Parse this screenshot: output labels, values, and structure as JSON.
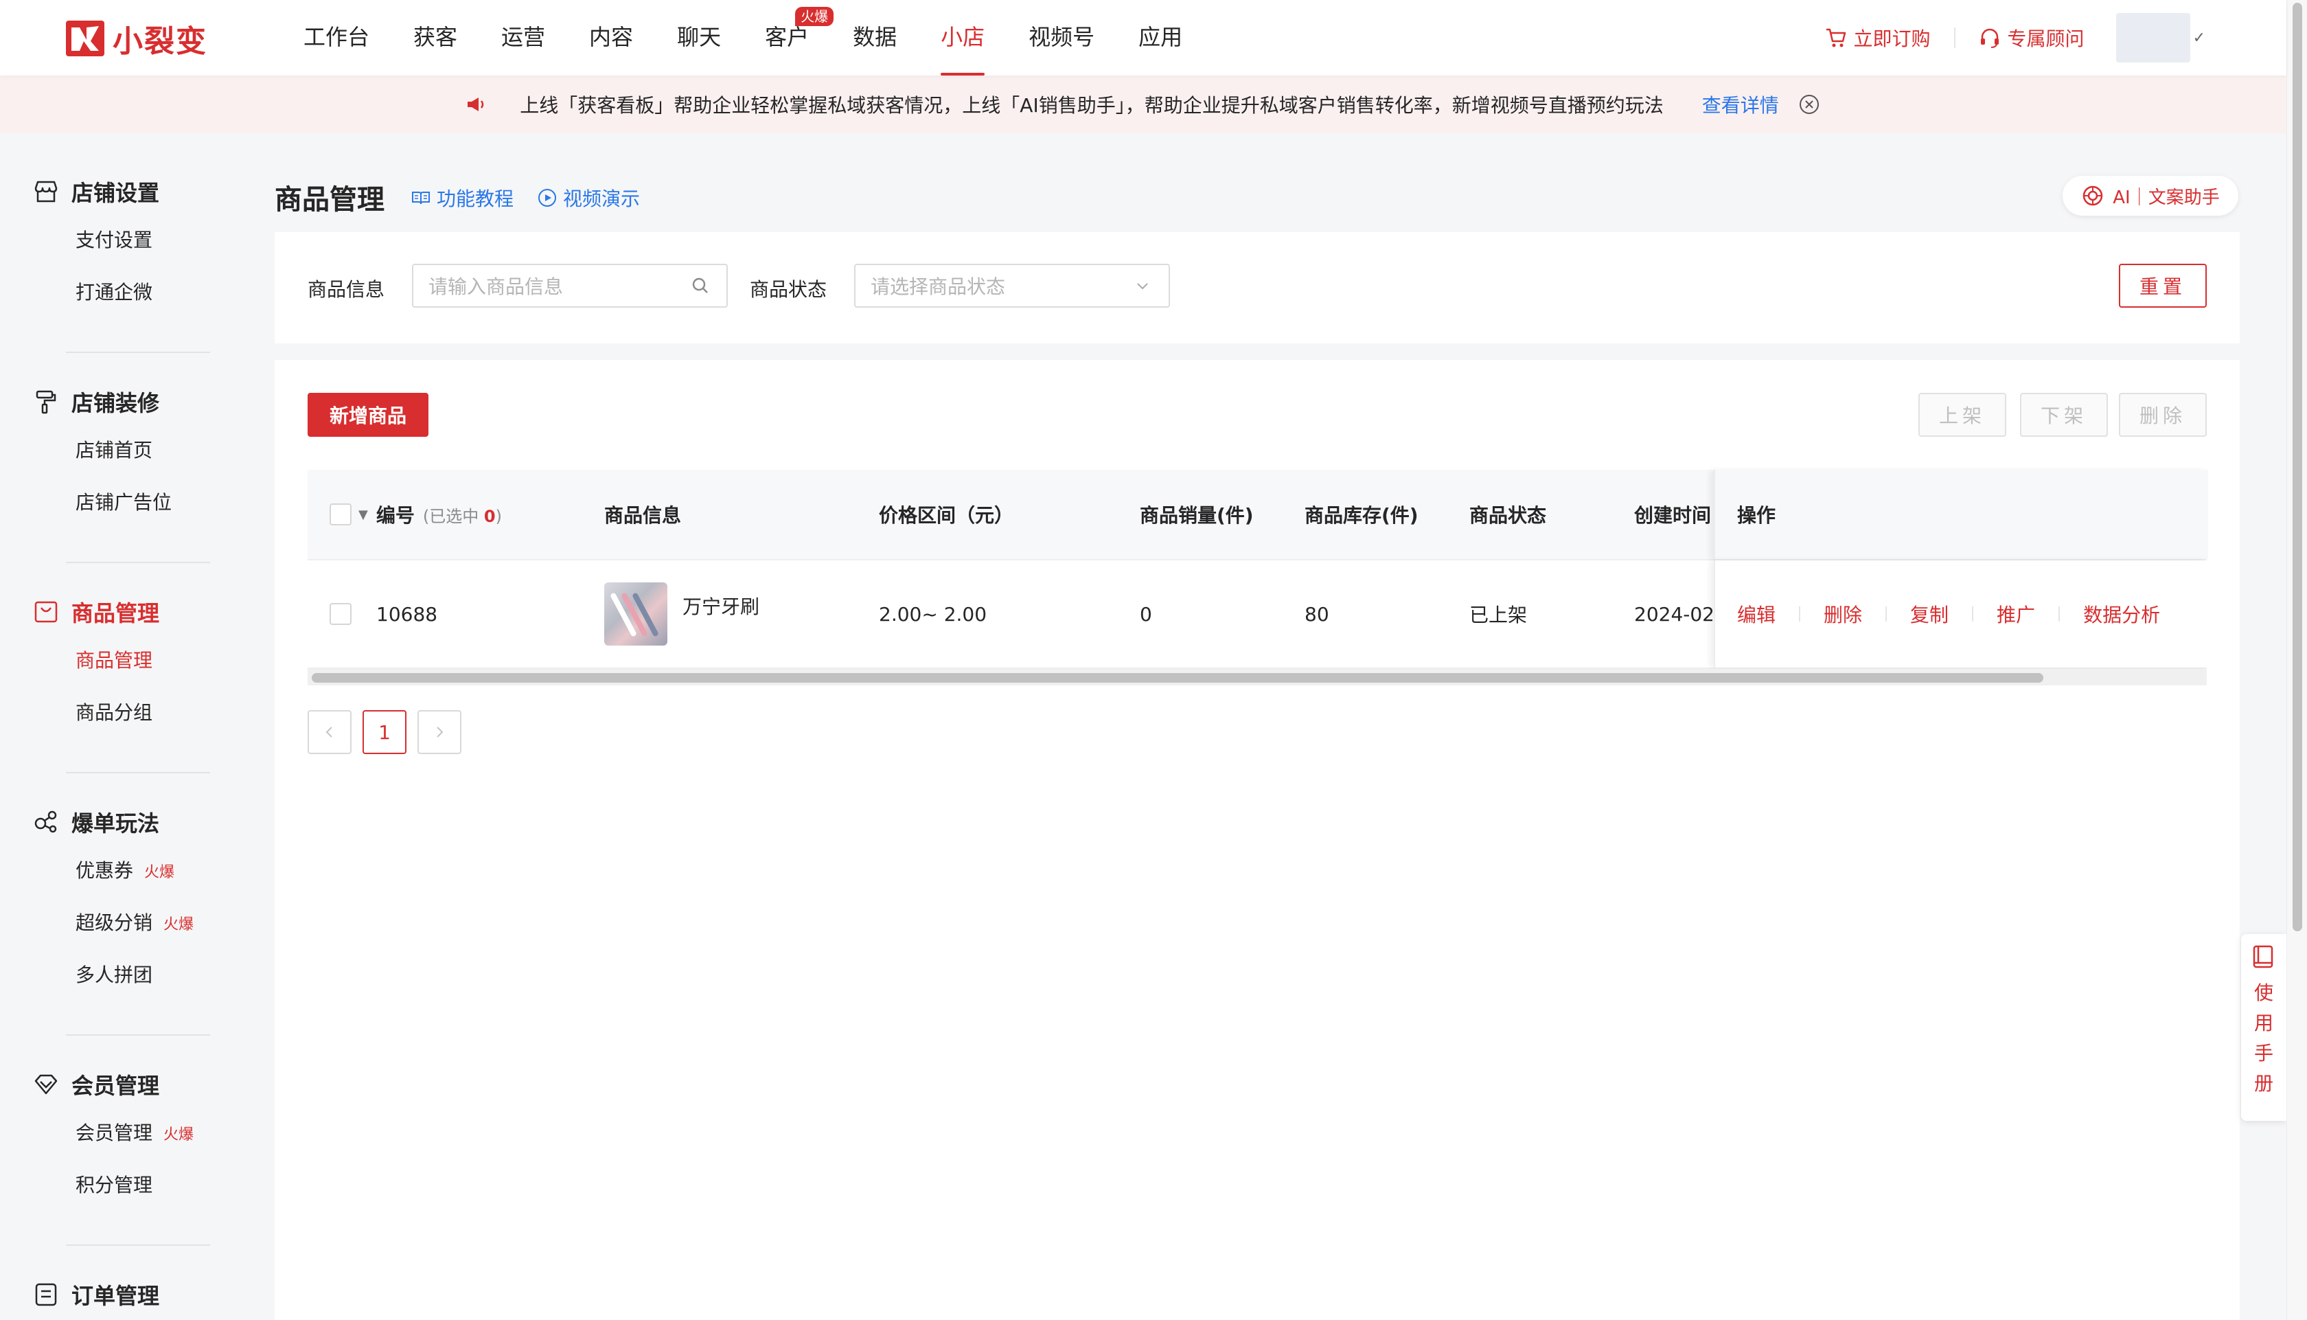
{
  "brand": {
    "name": "小裂变"
  },
  "nav": {
    "items": [
      {
        "label": "工作台"
      },
      {
        "label": "获客"
      },
      {
        "label": "运营"
      },
      {
        "label": "内容"
      },
      {
        "label": "聊天"
      },
      {
        "label": "客户",
        "badge": "火爆"
      },
      {
        "label": "数据"
      },
      {
        "label": "小店",
        "active": true
      },
      {
        "label": "视频号"
      },
      {
        "label": "应用"
      }
    ],
    "order_now": "立即订购",
    "advisor": "专属顾问"
  },
  "notice": {
    "text": "上线「获客看板」帮助企业轻松掌握私域获客情况，上线「AI销售助手」，帮助企业提升私域客户销售转化率，新增视频号直播预约玩法",
    "link": "查看详情"
  },
  "sidebar": {
    "groups": [
      {
        "title": "店铺设置",
        "icon": "store-icon",
        "items": [
          {
            "label": "支付设置"
          },
          {
            "label": "打通企微"
          }
        ]
      },
      {
        "title": "店铺装修",
        "icon": "paint-roller-icon",
        "items": [
          {
            "label": "店铺首页"
          },
          {
            "label": "店铺广告位"
          }
        ]
      },
      {
        "title": "商品管理",
        "icon": "shopping-bag-icon",
        "active": true,
        "items": [
          {
            "label": "商品管理",
            "active": true
          },
          {
            "label": "商品分组"
          }
        ]
      },
      {
        "title": "爆单玩法",
        "icon": "share-nodes-icon",
        "items": [
          {
            "label": "优惠券",
            "hot": "火爆"
          },
          {
            "label": "超级分销",
            "hot": "火爆"
          },
          {
            "label": "多人拼团"
          }
        ]
      },
      {
        "title": "会员管理",
        "icon": "diamond-icon",
        "items": [
          {
            "label": "会员管理",
            "hot": "火爆"
          },
          {
            "label": "积分管理"
          }
        ]
      },
      {
        "title": "订单管理",
        "icon": "order-list-icon",
        "items": []
      }
    ]
  },
  "page": {
    "title": "商品管理",
    "tutorial": "功能教程",
    "video_demo": "视频演示",
    "ai_assistant": "AI｜文案助手"
  },
  "filters": {
    "product_info_label": "商品信息",
    "product_info_placeholder": "请输入商品信息",
    "product_status_label": "商品状态",
    "product_status_placeholder": "请选择商品状态",
    "reset": "重置"
  },
  "actions": {
    "add_product": "新增商品",
    "list_on": "上架",
    "list_off": "下架",
    "delete": "删除"
  },
  "table": {
    "columns": {
      "id": "编号",
      "selected_prefix": "(已选中",
      "selected_count": "0",
      "selected_suffix": ")",
      "product_info": "商品信息",
      "price_range": "价格区间（元）",
      "sales": "商品销量(件)",
      "stock": "商品库存(件)",
      "status": "商品状态",
      "created": "创建时间",
      "operations": "操作"
    },
    "rows": [
      {
        "id": "10688",
        "name": "万宁牙刷",
        "price": "2.00~ 2.00",
        "sales": "0",
        "stock": "80",
        "status": "已上架",
        "created": "2024-02",
        "ops": [
          "编辑",
          "删除",
          "复制",
          "推广",
          "数据分析"
        ]
      }
    ]
  },
  "pagination": {
    "current": "1"
  },
  "manual": {
    "label": "使用手册"
  },
  "colors": {
    "brand": "#d82e2f",
    "link": "#2a77e8",
    "notice_bg": "#fbf0f0"
  }
}
